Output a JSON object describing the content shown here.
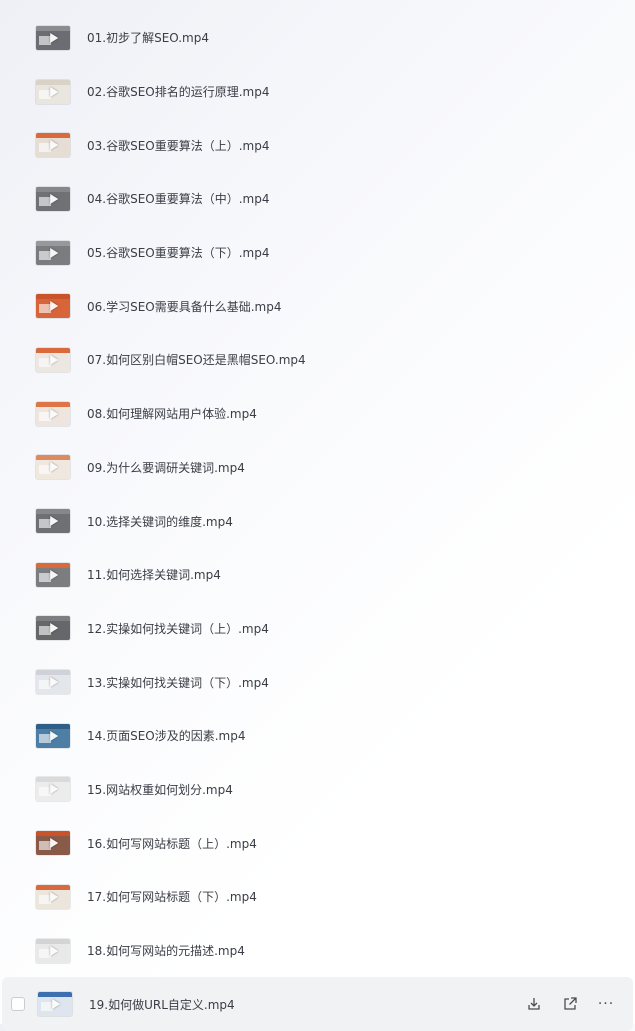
{
  "files": [
    {
      "name": "01.初步了解SEO.mp4",
      "thumb": "#6b6d72",
      "bar": "#8a8c90"
    },
    {
      "name": "02.谷歌SEO排名的运行原理.mp4",
      "thumb": "#e9e5df",
      "bar": "#d9d2c6"
    },
    {
      "name": "03.谷歌SEO重要算法（上）.mp4",
      "thumb": "#e6ddd4",
      "bar": "#d96a3b"
    },
    {
      "name": "04.谷歌SEO重要算法（中）.mp4",
      "thumb": "#6f7175",
      "bar": "#85878b"
    },
    {
      "name": "05.谷歌SEO重要算法（下）.mp4",
      "thumb": "#7a7c80",
      "bar": "#96989c"
    },
    {
      "name": "06.学习SEO需要具备什么基础.mp4",
      "thumb": "#d8643a",
      "bar": "#c9542b"
    },
    {
      "name": "07.如何区别白帽SEO还是黑帽SEO.mp4",
      "thumb": "#ece7e1",
      "bar": "#d96a3b"
    },
    {
      "name": "08.如何理解网站用户体验.mp4",
      "thumb": "#eee6de",
      "bar": "#de7547"
    },
    {
      "name": "09.为什么要调研关键词.mp4",
      "thumb": "#f0e7df",
      "bar": "#dc8a60"
    },
    {
      "name": "10.选择关键词的维度.mp4",
      "thumb": "#6e7074",
      "bar": "#85878b"
    },
    {
      "name": "11.如何选择关键词.mp4",
      "thumb": "#7b7d80",
      "bar": "#d96a3b"
    },
    {
      "name": "12.实操如何找关键词（上）.mp4",
      "thumb": "#65676b",
      "bar": "#7c7e82"
    },
    {
      "name": "13.实操如何找关键词（下）.mp4",
      "thumb": "#e3e6ea",
      "bar": "#cfd3d9"
    },
    {
      "name": "14.页面SEO涉及的因素.mp4",
      "thumb": "#4d7fa6",
      "bar": "#2f5f86"
    },
    {
      "name": "15.网站权重如何划分.mp4",
      "thumb": "#ececec",
      "bar": "#dadada"
    },
    {
      "name": "16.如何写网站标题（上）.mp4",
      "thumb": "#8a5a48",
      "bar": "#c9542b"
    },
    {
      "name": "17.如何写网站标题（下）.mp4",
      "thumb": "#ece5dc",
      "bar": "#d96a3b"
    },
    {
      "name": "18.如何写网站的元描述.mp4",
      "thumb": "#e9e9ea",
      "bar": "#d3d4d6"
    },
    {
      "name": "19.如何做URL自定义.mp4",
      "thumb": "#dfe5ee",
      "bar": "#3b6fb0",
      "active": true
    }
  ],
  "icons": {
    "download": "download-icon",
    "share": "share-icon",
    "more": "more-icon",
    "more_glyph": "···"
  }
}
